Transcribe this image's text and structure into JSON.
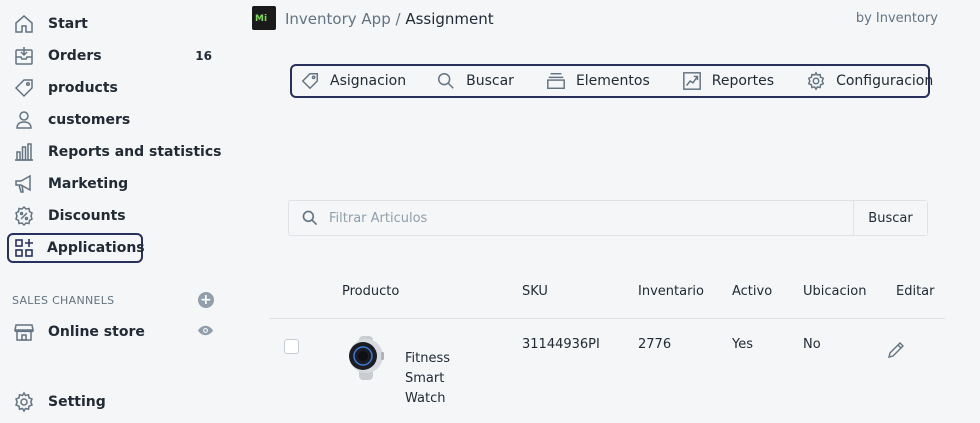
{
  "sidebar": {
    "items": [
      {
        "label": "Start",
        "icon": "home-icon"
      },
      {
        "label": "Orders",
        "icon": "orders-icon",
        "count": "16"
      },
      {
        "label": "products",
        "icon": "tag-icon"
      },
      {
        "label": "customers",
        "icon": "person-icon"
      },
      {
        "label": "Reports and statistics",
        "icon": "bar-chart-icon"
      },
      {
        "label": "Marketing",
        "icon": "megaphone-icon"
      },
      {
        "label": "Discounts",
        "icon": "discount-icon"
      },
      {
        "label": "Applications",
        "icon": "apps-icon",
        "active": true
      }
    ],
    "sales_channels_label": "SALES CHANNELS",
    "online_store_label": "Online store",
    "setting_label": "Setting"
  },
  "header": {
    "app_name": "Inventory App",
    "separator": "/",
    "current_page": "Assignment",
    "by_label": "by",
    "by_value": "Inventory"
  },
  "tabs": [
    {
      "label": "Asignacion",
      "icon": "tag-icon"
    },
    {
      "label": "Buscar",
      "icon": "search-icon"
    },
    {
      "label": "Elementos",
      "icon": "stack-icon"
    },
    {
      "label": "Reportes",
      "icon": "chart-icon"
    },
    {
      "label": "Configuracion",
      "icon": "gear-icon"
    }
  ],
  "search": {
    "placeholder": "Filtrar Articulos",
    "button_label": "Buscar"
  },
  "table": {
    "headers": {
      "product": "Producto",
      "sku": "SKU",
      "inventory": "Inventario",
      "active": "Activo",
      "location": "Ubicacion",
      "edit": "Editar"
    },
    "rows": [
      {
        "product": "Fitness Smart Watch",
        "sku": "31144936PI",
        "inventory": "2776",
        "active": "Yes",
        "location": "No"
      }
    ]
  },
  "colors": {
    "accent_border": "#28305e",
    "background": "#f4f6f8",
    "text": "#212b36",
    "muted": "#637381"
  }
}
